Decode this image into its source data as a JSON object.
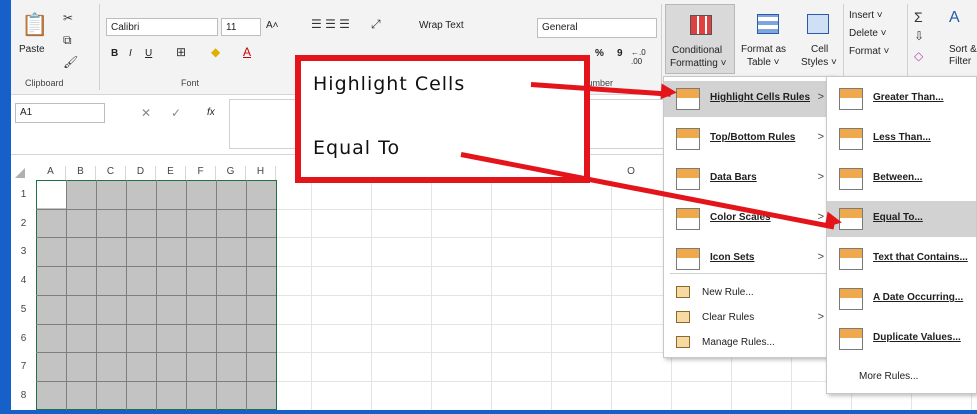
{
  "ribbon": {
    "clipboard": {
      "label": "Clipboard",
      "paste": "Paste"
    },
    "font": {
      "label": "Font",
      "family": "Calibri",
      "size": "11",
      "grow": "A˄",
      "shrink": "A˅",
      "bold": "B",
      "italic": "I",
      "underline": "U"
    },
    "alignment": {
      "wrap": "Wrap Text"
    },
    "number": {
      "format": "General",
      "label": "Number",
      "percent": "%",
      "comma": "9"
    },
    "styles": {
      "cond_fmt": [
        "Conditional",
        "Formatting ˅"
      ],
      "format_table": [
        "Format as",
        "Table ˅"
      ],
      "cell_styles": [
        "Cell",
        "Styles ˅"
      ]
    },
    "cells": {
      "insert": "Insert ˅",
      "delete": "Delete ˅",
      "format": "Format ˅"
    },
    "editing": {
      "sort": "Sort &",
      "filter": "Filter"
    }
  },
  "formula_bar": {
    "name_box": "A1",
    "fx": "fx"
  },
  "grid": {
    "columns": [
      "A",
      "B",
      "C",
      "D",
      "E",
      "F",
      "G",
      "H"
    ],
    "extra_column": "O",
    "rows": [
      "1",
      "2",
      "3",
      "4",
      "5",
      "6",
      "7",
      "8"
    ]
  },
  "cf_menu": {
    "items": [
      {
        "label": "Highlight Cells Rules",
        "arrow": ">"
      },
      {
        "label": "Top/Bottom Rules",
        "arrow": ">"
      },
      {
        "label": "Data Bars",
        "arrow": ">"
      },
      {
        "label": "Color Scales",
        "arrow": ">"
      },
      {
        "label": "Icon Sets",
        "arrow": ">"
      }
    ],
    "small_items": [
      {
        "label": "New Rule..."
      },
      {
        "label": "Clear Rules",
        "arrow": ">"
      },
      {
        "label": "Manage Rules..."
      }
    ]
  },
  "hc_menu": {
    "items": [
      {
        "label": "Greater Than..."
      },
      {
        "label": "Less Than..."
      },
      {
        "label": "Between..."
      },
      {
        "label": "Equal To..."
      },
      {
        "label": "Text that Contains..."
      },
      {
        "label": "A Date Occurring..."
      },
      {
        "label": "Duplicate Values..."
      }
    ],
    "more": "More Rules..."
  },
  "callout": {
    "line1": "Highlight  Cells",
    "line2": "Equal  To"
  }
}
